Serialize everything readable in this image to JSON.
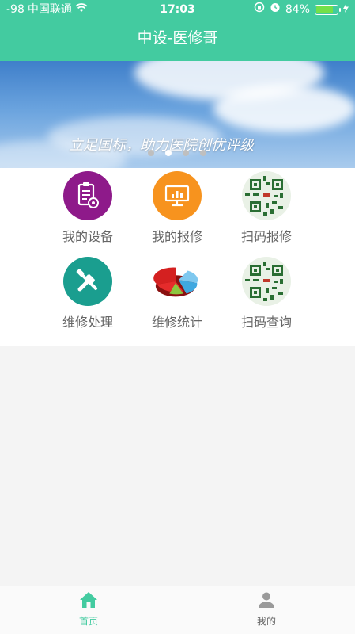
{
  "status_bar": {
    "signal": "-98",
    "carrier": "中国联通",
    "time": "17:03",
    "battery": "84%",
    "battery_level": 0.84
  },
  "nav": {
    "title": "中设-医修哥"
  },
  "banner": {
    "slogan": "立足国标，助力医院创优评级",
    "page_count": 4,
    "active_page": 1
  },
  "menu": {
    "items": [
      {
        "label": "我的设备",
        "icon": "device-settings-icon",
        "color": "#8e1a8a"
      },
      {
        "label": "我的报修",
        "icon": "monitor-chart-icon",
        "color": "#f7931e"
      },
      {
        "label": "扫码报修",
        "icon": "qr-code-icon",
        "color": "#2a6e33"
      },
      {
        "label": "维修处理",
        "icon": "tools-icon",
        "color": "#1a9e8f"
      },
      {
        "label": "维修统计",
        "icon": "pie-chart-icon",
        "color": "#d42020"
      },
      {
        "label": "扫码查询",
        "icon": "qr-code-icon",
        "color": "#2a6e33"
      }
    ]
  },
  "tabbar": {
    "tabs": [
      {
        "label": "首页",
        "icon": "home-icon",
        "active": true
      },
      {
        "label": "我的",
        "icon": "user-icon",
        "active": false
      }
    ]
  },
  "colors": {
    "primary": "#43cba0",
    "tab_active": "#43cba0",
    "tab_inactive": "#888888"
  }
}
